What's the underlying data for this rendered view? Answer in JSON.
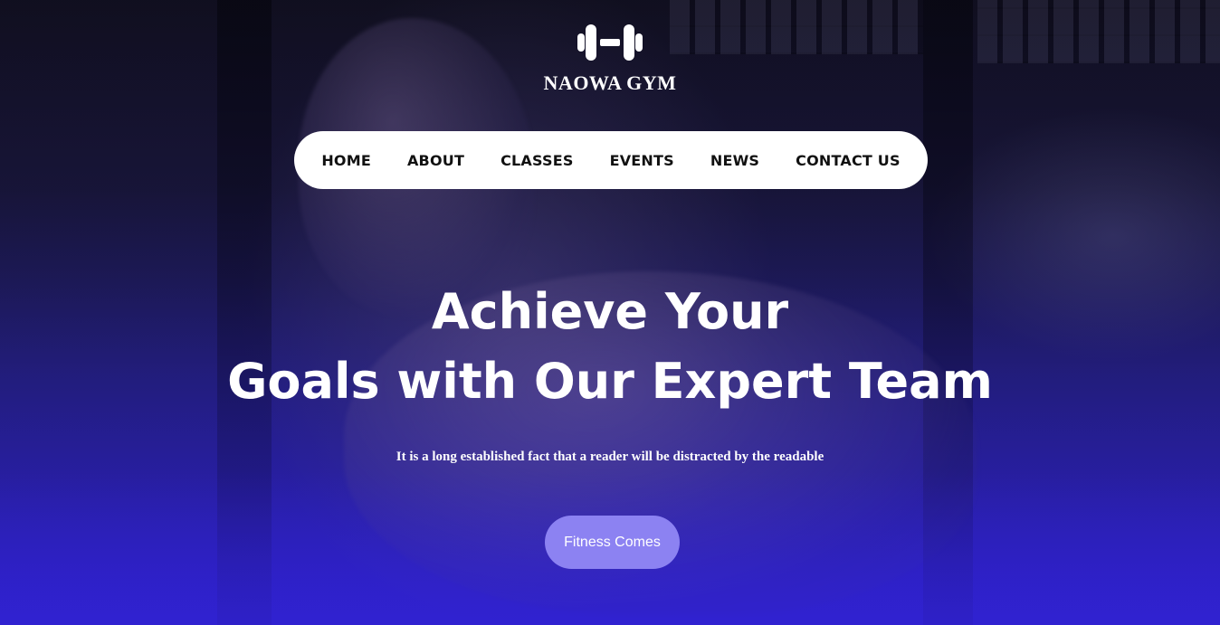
{
  "brand": {
    "name": "NAOWA GYM",
    "icon": "dumbbell-icon"
  },
  "nav": {
    "items": [
      {
        "label": "HOME"
      },
      {
        "label": "ABOUT"
      },
      {
        "label": "CLASSES"
      },
      {
        "label": "EVENTS"
      },
      {
        "label": "NEWS"
      },
      {
        "label": "CONTACT US"
      }
    ]
  },
  "hero": {
    "headline_line1": "Achieve Your",
    "headline_line2": "Goals with Our Expert Team",
    "subtext": "It is a long established fact that a reader will be distracted by the readable",
    "cta_label": "Fitness Comes"
  },
  "colors": {
    "cta_background": "#8c82f2",
    "nav_background": "#ffffff",
    "overlay_accent": "#2f22c9"
  }
}
